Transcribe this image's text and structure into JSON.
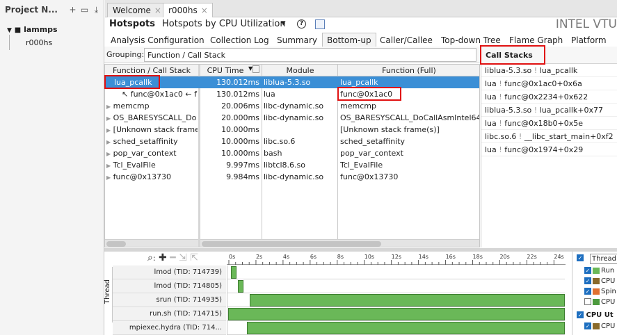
{
  "project_nav": {
    "title": "Project N...",
    "root": "lammps",
    "child": "r000hs"
  },
  "tabs": [
    {
      "label": "Welcome"
    },
    {
      "label": "r000hs"
    }
  ],
  "header": {
    "title": "Hotspots",
    "subtitle": "Hotspots by CPU Utilization",
    "brand": "INTEL VTU"
  },
  "subtabs": [
    "Analysis Configuration",
    "Collection Log",
    "Summary",
    "Bottom-up",
    "Caller/Callee",
    "Top-down Tree",
    "Flame Graph",
    "Platform"
  ],
  "grouping": {
    "label": "Grouping:",
    "value": "Function / Call Stack"
  },
  "table": {
    "columns": [
      "Function / Call Stack",
      "CPU Time",
      "Module",
      "Function (Full)"
    ],
    "rows": [
      {
        "name": "lua_pcallk",
        "time": "130.012ms",
        "module": "liblua-5.3.so",
        "func": "lua_pcallk"
      },
      {
        "name": "↖ func@0x1ac0 ← f",
        "time": "130.012ms",
        "module": "lua",
        "func": "func@0x1ac0"
      },
      {
        "name": "memcmp",
        "time": "20.006ms",
        "module": "libc-dynamic.so",
        "func": "memcmp"
      },
      {
        "name": "OS_BARESYSCALL_Do",
        "time": "20.000ms",
        "module": "libc-dynamic.so",
        "func": "OS_BARESYSCALL_DoCallAsmIntel64"
      },
      {
        "name": "[Unknown stack frame",
        "time": "10.000ms",
        "module": "",
        "func": "[Unknown stack frame(s)]"
      },
      {
        "name": "sched_setaffinity",
        "time": "10.000ms",
        "module": "libc.so.6",
        "func": "sched_setaffinity"
      },
      {
        "name": "pop_var_context",
        "time": "10.000ms",
        "module": "bash",
        "func": "pop_var_context"
      },
      {
        "name": "Tcl_EvalFile",
        "time": "9.997ms",
        "module": "libtcl8.6.so",
        "func": "Tcl_EvalFile"
      },
      {
        "name": "func@0x13730",
        "time": "9.984ms",
        "module": "libc-dynamic.so",
        "func": "func@0x13730"
      }
    ]
  },
  "call_stacks": {
    "title": "Call Stacks",
    "items": [
      {
        "module": "liblua-5.3.so",
        "func": "lua_pcallk"
      },
      {
        "module": "lua",
        "func": "func@0x1ac0+0x6a"
      },
      {
        "module": "lua",
        "func": "func@0x2234+0x622"
      },
      {
        "module": "liblua-5.3.so",
        "func": "lua_pcallk+0x77"
      },
      {
        "module": "lua",
        "func": "func@0x18b0+0x5e"
      },
      {
        "module": "libc.so.6",
        "func": "__libc_start_main+0xf2"
      },
      {
        "module": "lua",
        "func": "func@0x1974+0x29"
      }
    ]
  },
  "timeline": {
    "axis_label": "Thread",
    "ticks": [
      "0s",
      "2s",
      "4s",
      "6s",
      "8s",
      "10s",
      "12s",
      "14s",
      "16s",
      "18s",
      "20s",
      "22s",
      "24s"
    ],
    "max_seconds": 24.7,
    "threads": [
      {
        "label": "lmod (TID: 714739)",
        "start": 0.2,
        "end": 0.6
      },
      {
        "label": "lmod (TID: 714805)",
        "start": 0.7,
        "end": 1.1
      },
      {
        "label": "srun (TID: 714935)",
        "start": 1.6,
        "end": 24.7
      },
      {
        "label": "run.sh (TID: 714715)",
        "start": 0.0,
        "end": 24.7
      },
      {
        "label": "mpiexec.hydra (TID: 714...",
        "start": 1.4,
        "end": 24.7
      }
    ]
  },
  "legend": {
    "select": "Thread",
    "items": [
      "Run",
      "CPU",
      "Spin",
      "CPU"
    ],
    "group2": "CPU Ut",
    "group2_item": "CPU"
  },
  "colors": {
    "selection": "#3b8fd6",
    "running": "#6ab858",
    "highlight": "#e01010"
  }
}
